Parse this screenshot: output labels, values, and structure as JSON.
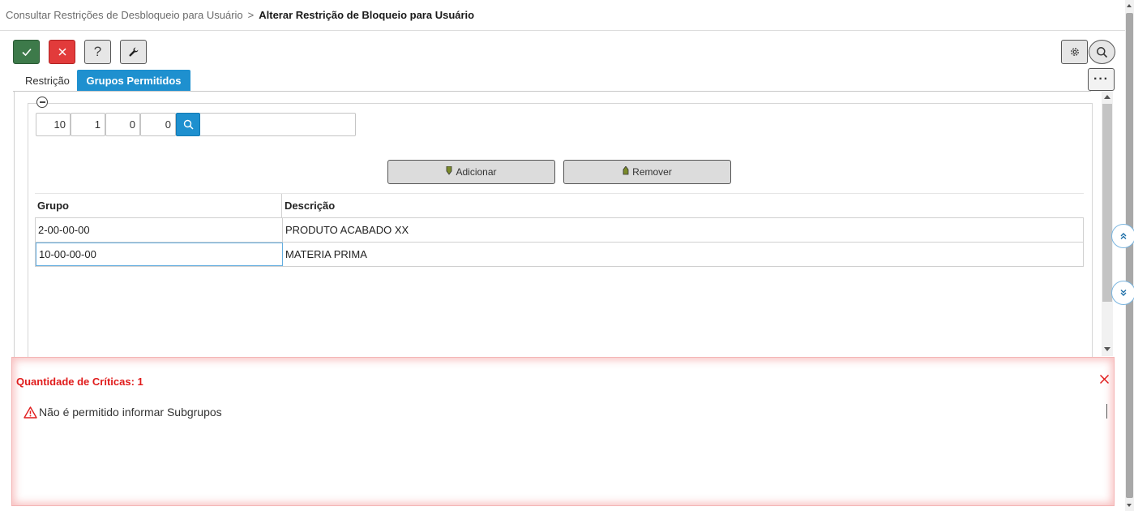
{
  "breadcrumb": {
    "previous": "Consultar Restrições de Desbloqueio para Usuário",
    "separator": ">",
    "current": "Alterar Restrição de Bloqueio para Usuário"
  },
  "toolbar": {
    "help_label": "?",
    "more_label": "···"
  },
  "tabs": [
    {
      "label": "Restrição",
      "active": false
    },
    {
      "label": "Grupos Permitidos",
      "active": true
    }
  ],
  "code_inputs": [
    "10",
    "1",
    "0",
    "0"
  ],
  "actions": {
    "add_label": "Adicionar",
    "remove_label": "Remover"
  },
  "grid": {
    "columns": [
      "Grupo",
      "Descrição"
    ],
    "rows": [
      {
        "grupo": "2-00-00-00",
        "descricao": "PRODUTO ACABADO XX"
      },
      {
        "grupo": "10-00-00-00",
        "descricao": "MATERIA PRIMA"
      }
    ]
  },
  "errors": {
    "title": "Quantidade de Críticas: 1",
    "messages": [
      "Não é permitido informar Subgrupos"
    ]
  },
  "colors": {
    "confirm": "#3d7a4a",
    "cancel": "#e23b3b",
    "accent": "#1e90cf",
    "error": "#e01b1b"
  },
  "icons": {
    "confirm": "check-icon",
    "cancel": "close-icon",
    "help": "question-icon",
    "tools": "wrench-icon",
    "settings": "gear-icon",
    "search": "search-icon",
    "collapse": "minus-circle-icon",
    "warning": "warning-triangle-icon"
  }
}
